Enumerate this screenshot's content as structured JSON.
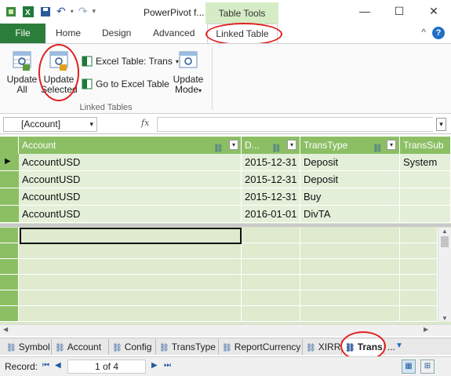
{
  "window": {
    "title": "PowerPivot f...",
    "context_tab": "Table Tools",
    "minimize": "—",
    "maximize": "☐",
    "close": "✕"
  },
  "ribbon_tabs": {
    "file": "File",
    "home": "Home",
    "design": "Design",
    "advanced": "Advanced",
    "linked_table": "Linked Table",
    "collapse": "^",
    "help": "?"
  },
  "ribbon": {
    "update_all": "Update\nAll",
    "update_selected": "Update\nSelected",
    "excel_table": "Excel Table: Trans",
    "goto_excel": "Go to Excel Table",
    "update_mode": "Update\nMode",
    "group_label": "Linked Tables"
  },
  "formula_bar": {
    "name_box": "[Account]",
    "fx": "fx",
    "value": ""
  },
  "columns": [
    "Account",
    "D...",
    "TransType",
    "TransSub"
  ],
  "rows": [
    [
      "AccountUSD",
      "2015-12-31",
      "Deposit",
      "System"
    ],
    [
      "AccountUSD",
      "2015-12-31",
      "Deposit",
      ""
    ],
    [
      "AccountUSD",
      "2015-12-31",
      "Buy",
      ""
    ],
    [
      "AccountUSD",
      "2016-01-01",
      "DivTA",
      ""
    ]
  ],
  "sheet_tabs": [
    "Symbol",
    "Account",
    "Config",
    "TransType",
    "ReportCurrency",
    "XIRR",
    "Trans"
  ],
  "active_sheet": "Trans",
  "sheet_more": "...",
  "status": {
    "record_label": "Record:",
    "record_value": "1 of 4"
  },
  "colors": {
    "file_tab": "#2b7d3a",
    "header": "#8cbf64",
    "cell": "#e4efd9",
    "highlight_oval": "#e02020"
  }
}
